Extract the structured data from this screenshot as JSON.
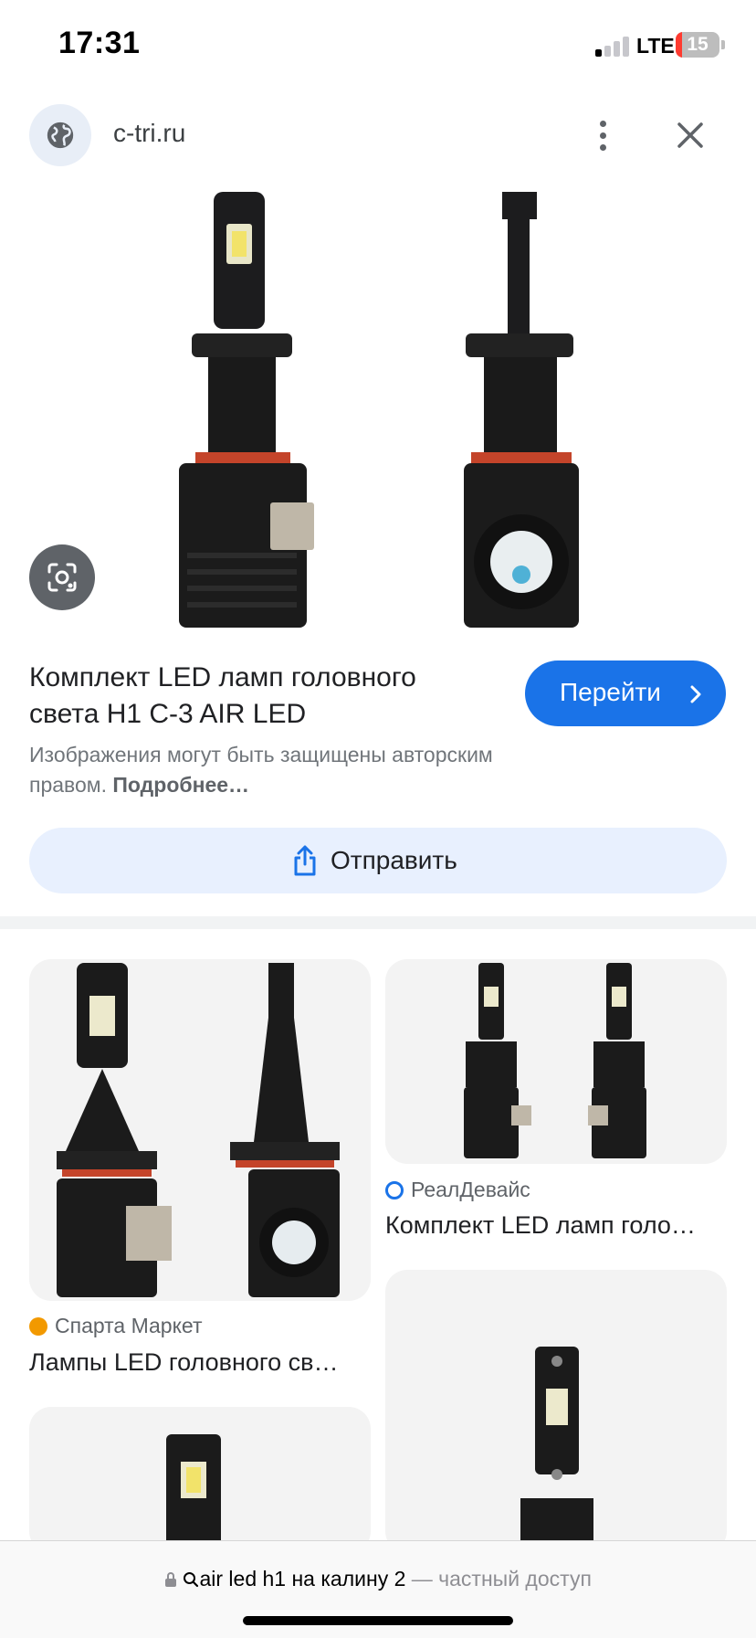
{
  "status": {
    "time": "17:31",
    "network": "LTE",
    "battery": "15"
  },
  "header": {
    "site": "c-tri.ru",
    "globe_icon": "globe-icon",
    "more_icon": "more-vert-icon",
    "close_icon": "close-icon"
  },
  "result": {
    "title": "Комплект LED ламп головного света H1 C-3 AIR LED",
    "go_label": "Перейти",
    "copyright_text": "Изображения могут быть защищены авторским правом.",
    "copyright_link": "Подробнее…",
    "share_label": "Отправить"
  },
  "related": [
    {
      "source": "Спарта Маркет",
      "title": "Лампы LED головного св…"
    },
    {
      "source": "РеалДевайс",
      "title": "Комплект LED ламп голо…"
    }
  ],
  "browser": {
    "query": "air led h1 на калину 2",
    "mode": "— частный доступ"
  },
  "colors": {
    "accent": "#1a73e8",
    "share_bg": "#e8f0fe",
    "battery_low": "#ff3b30"
  }
}
